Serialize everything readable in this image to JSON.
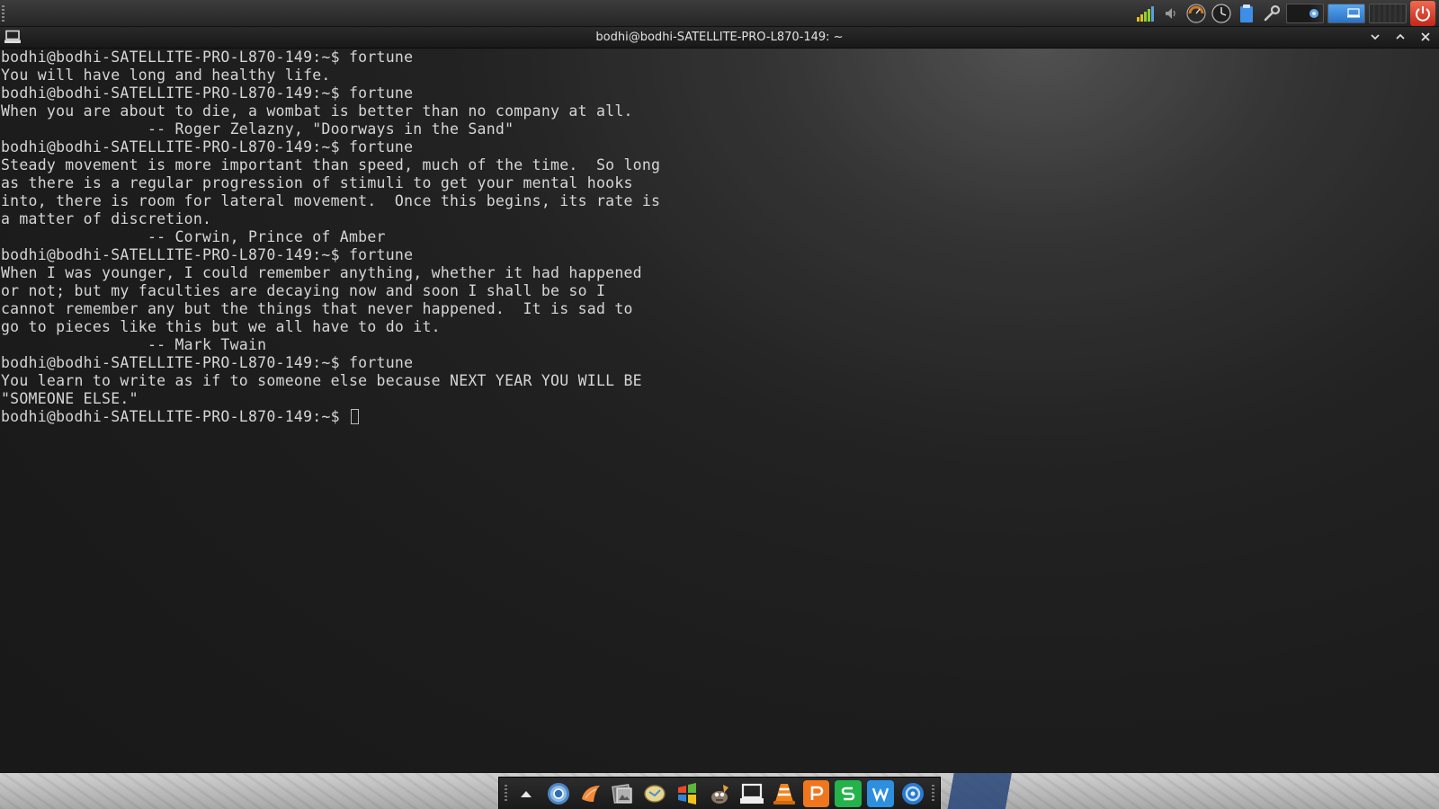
{
  "window": {
    "title": "bodhi@bodhi-SATELLITE-PRO-L870-149: ~"
  },
  "terminal": {
    "lines": [
      "bodhi@bodhi-SATELLITE-PRO-L870-149:~$ fortune",
      "You will have long and healthy life.",
      "bodhi@bodhi-SATELLITE-PRO-L870-149:~$ fortune",
      "When you are about to die, a wombat is better than no company at all.",
      "                -- Roger Zelazny, \"Doorways in the Sand\"",
      "bodhi@bodhi-SATELLITE-PRO-L870-149:~$ fortune",
      "Steady movement is more important than speed, much of the time.  So long",
      "as there is a regular progression of stimuli to get your mental hooks",
      "into, there is room for lateral movement.  Once this begins, its rate is",
      "a matter of discretion.",
      "                -- Corwin, Prince of Amber",
      "bodhi@bodhi-SATELLITE-PRO-L870-149:~$ fortune",
      "When I was younger, I could remember anything, whether it had happened",
      "or not; but my faculties are decaying now and soon I shall be so I",
      "cannot remember any but the things that never happened.  It is sad to",
      "go to pieces like this but we all have to do it.",
      "                -- Mark Twain",
      "bodhi@bodhi-SATELLITE-PRO-L870-149:~$ fortune",
      "You learn to write as if to someone else because NEXT YEAR YOU WILL BE",
      "\"SOMEONE ELSE.\""
    ],
    "current_prompt": "bodhi@bodhi-SATELLITE-PRO-L870-149:~$ "
  },
  "tray": {
    "icons": [
      "signal-bars-icon",
      "volume-icon",
      "cpu-meter-icon",
      "clock-icon",
      "clipboard-icon",
      "settings-wrench-icon",
      "network-icon",
      "workspace-switcher-icon",
      "power-icon"
    ]
  },
  "dock": {
    "items": [
      "show-desktop",
      "chromium",
      "thunar-file-manager",
      "image-viewer",
      "gimp",
      "paint",
      "system-settings",
      "terminal",
      "vlc",
      "wps-presentation",
      "wps-spreadsheets",
      "wps-writer",
      "browser"
    ]
  },
  "colors": {
    "terminal_text": "#d6d6d6",
    "terminal_bg": "#1f1f1f",
    "title_text": "#e2e2e2"
  }
}
